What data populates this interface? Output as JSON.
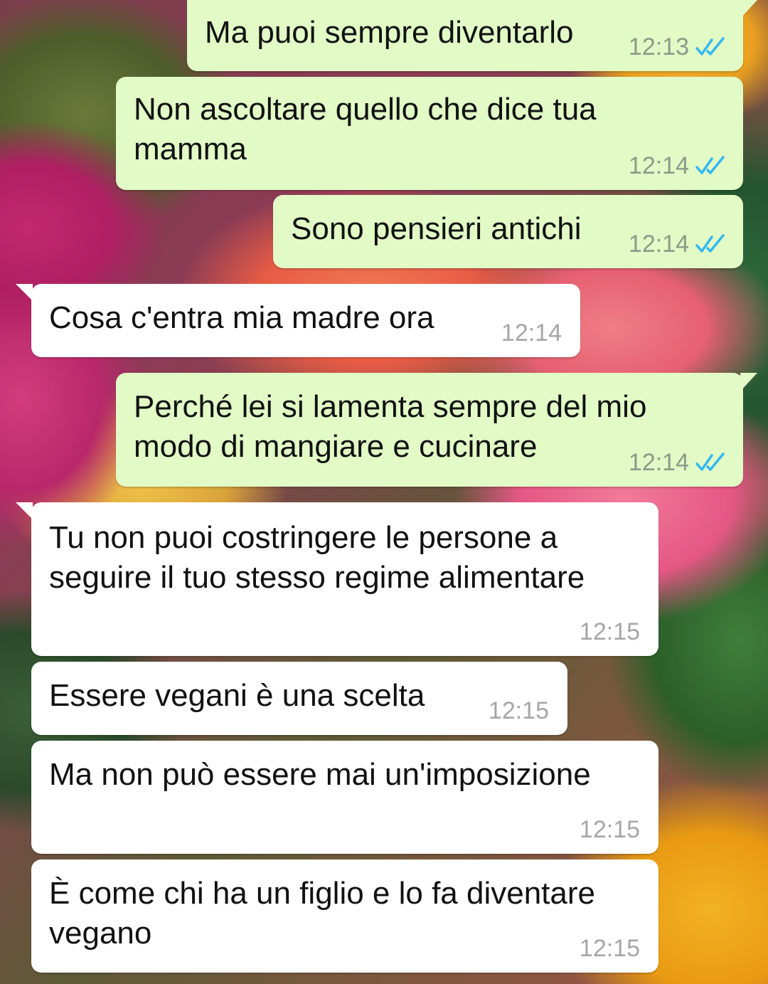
{
  "messages": [
    {
      "direction": "out",
      "text": "Ma puoi sempre diventarlo",
      "time": "12:13",
      "status": "read-double-tick"
    },
    {
      "direction": "out",
      "text": "Non ascoltare quello che dice tua\nmamma",
      "time": "12:14",
      "status": "read-double-tick"
    },
    {
      "direction": "out",
      "text": "Sono pensieri antichi",
      "time": "12:14",
      "status": "read-double-tick"
    },
    {
      "direction": "in",
      "text": "Cosa c'entra mia madre ora",
      "time": "12:14"
    },
    {
      "direction": "out",
      "text": "Perché lei si lamenta sempre del mio\nmodo di mangiare e cucinare",
      "time": "12:14",
      "status": "read-double-tick"
    },
    {
      "direction": "in",
      "text": "Tu non puoi costringere le persone a\nseguire il tuo stesso regime alimentare",
      "time": "12:15"
    },
    {
      "direction": "in",
      "text": "Essere vegani è una scelta",
      "time": "12:15"
    },
    {
      "direction": "in",
      "text": "Ma non può essere mai un'imposizione",
      "time": "12:15"
    },
    {
      "direction": "in",
      "text": "È come chi ha un figlio e lo fa diventare\nvegano",
      "time": "12:15"
    }
  ],
  "colors": {
    "outgoing_bubble": "#e1fac6",
    "incoming_bubble": "#ffffff",
    "read_ticks": "#34b7f1",
    "timestamp_out": "#8c9a88",
    "timestamp_in": "#a6a6a6"
  },
  "icons": {
    "read_status": "double-check-icon"
  }
}
